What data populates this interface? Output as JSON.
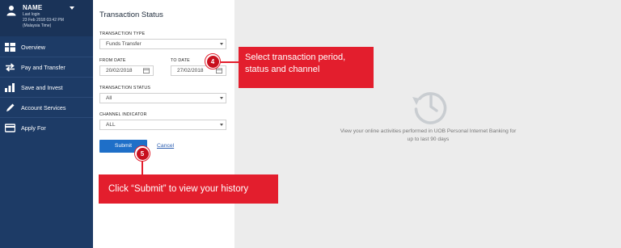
{
  "profile": {
    "name": "NAME",
    "last_login_label": "Last login",
    "last_login_time": "23 Feb 2018 03:42 PM",
    "timezone": "(Malaysia Time)"
  },
  "nav": [
    {
      "label": "Overview",
      "icon": "overview-icon"
    },
    {
      "label": "Pay and Transfer",
      "icon": "transfer-icon"
    },
    {
      "label": "Save and Invest",
      "icon": "chart-icon"
    },
    {
      "label": "Account Services",
      "icon": "pencil-icon"
    },
    {
      "label": "Apply For",
      "icon": "card-icon"
    }
  ],
  "form": {
    "title": "Transaction Status",
    "transaction_type_label": "TRANSACTION TYPE",
    "transaction_type_value": "Funds Transfer",
    "from_date_label": "FROM DATE",
    "from_date_value": "20/02/2018",
    "to_date_label": "TO DATE",
    "to_date_value": "27/02/2018",
    "transaction_status_label": "TRANSACTION STATUS",
    "transaction_status_value": "All",
    "channel_label": "CHANNEL INDICATOR",
    "channel_value": "ALL",
    "submit_label": "Submit",
    "cancel_label": "Cancel"
  },
  "empty_state": {
    "line1": "View your online activities performed in UOB Personal Internet Banking for",
    "line2": "up to last 90 days"
  },
  "callouts": {
    "step4_number": "4",
    "step4_line1": "Select transaction period,",
    "step4_line2": "status and channel",
    "step5_number": "5",
    "step5_text": "Click “Submit” to view your history"
  },
  "colors": {
    "sidebar": "#1d3b66",
    "accent_red": "#e31e2d",
    "submit_blue": "#1e6fc8"
  }
}
